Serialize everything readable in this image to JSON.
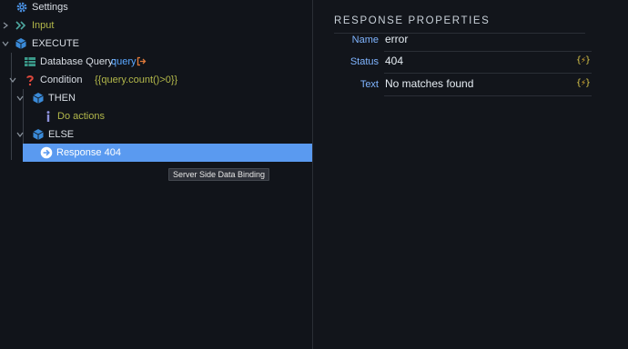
{
  "tree": {
    "settings": "Settings",
    "input": "Input",
    "execute": "EXECUTE",
    "db_query_label": "Database Query:",
    "db_query_name": "query",
    "condition_label": "Condition",
    "condition_expr": "{{query.count()>0}}",
    "then": "THEN",
    "do_actions": "Do actions",
    "else": "ELSE",
    "response": "Response 404"
  },
  "tooltip": "Server Side Data Binding",
  "properties": {
    "title": "RESPONSE PROPERTIES",
    "name_label": "Name",
    "name_value": "error",
    "status_label": "Status",
    "status_value": "404",
    "text_label": "Text",
    "text_value": "No matches found"
  },
  "colors": {
    "background": "#12151b",
    "selected": "#5a9af0",
    "accent_blue": "#5aa7ff",
    "olive": "#b3b84a"
  }
}
